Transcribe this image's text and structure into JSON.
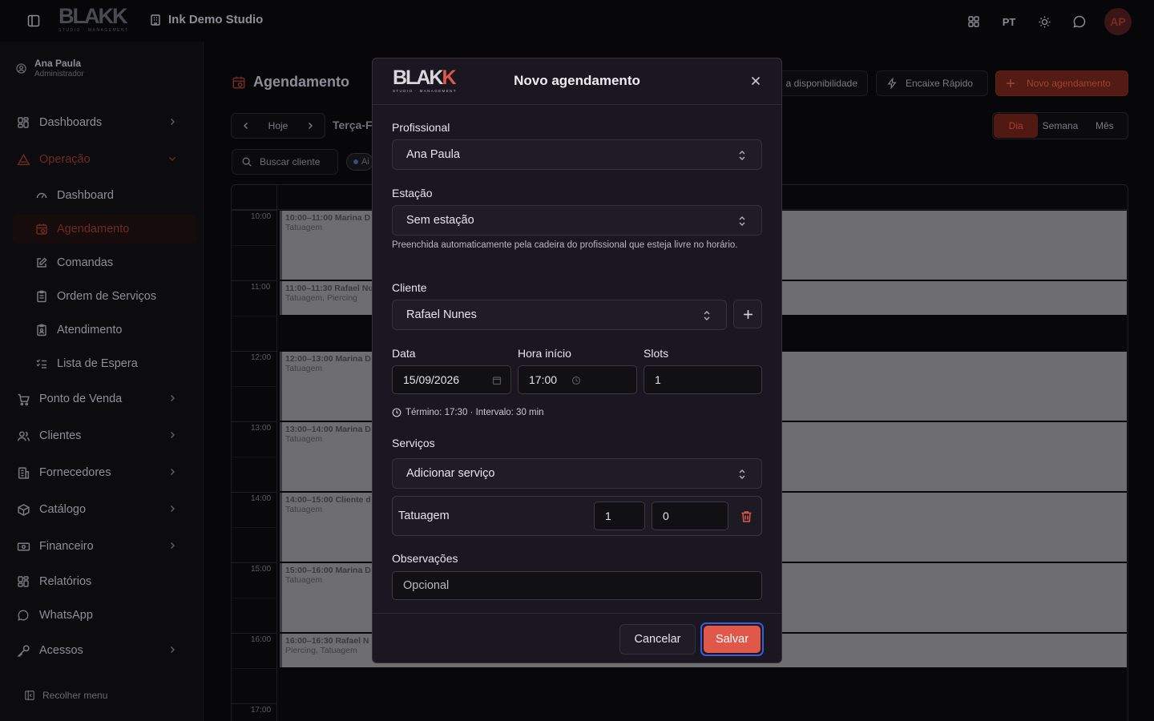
{
  "app": {
    "studio": "Ink Demo Studio",
    "logo": "BLAKK",
    "logo_sub": "STUDIO · MANAGEMENT"
  },
  "topbar": {
    "lang": "PT",
    "avatar": "AP"
  },
  "user": {
    "name": "Ana Paula",
    "role": "Administrador"
  },
  "sidebar": {
    "items": [
      {
        "label": "Dashboards",
        "icon": "grid-icon"
      },
      {
        "label": "Operação",
        "icon": "warning-icon"
      },
      {
        "label": "Ponto de Venda",
        "icon": "cart-icon"
      },
      {
        "label": "Clientes",
        "icon": "users-icon"
      },
      {
        "label": "Fornecedores",
        "icon": "building-icon"
      },
      {
        "label": "Catálogo",
        "icon": "box-icon"
      },
      {
        "label": "Financeiro",
        "icon": "banknote-icon"
      },
      {
        "label": "Relatórios",
        "icon": "grid-icon"
      },
      {
        "label": "WhatsApp",
        "icon": "chat-icon"
      },
      {
        "label": "Acessos",
        "icon": "key-icon"
      }
    ],
    "sub": [
      {
        "label": "Dashboard",
        "icon": "gauge-icon"
      },
      {
        "label": "Agendamento",
        "icon": "calendar-icon"
      },
      {
        "label": "Comandas",
        "icon": "edit-icon"
      },
      {
        "label": "Ordem de Serviços",
        "icon": "clipboard-icon"
      },
      {
        "label": "Atendimento",
        "icon": "clipboard-icon"
      },
      {
        "label": "Lista de Espera",
        "icon": "list-icon"
      }
    ],
    "collapse": "Recolher menu"
  },
  "page": {
    "title": "Agendamento",
    "actions": {
      "availability": "a disponibilidade",
      "quick_fit": "Encaixe Rápido",
      "new": "Novo agendamento"
    },
    "nav": {
      "today": "Hoje"
    },
    "date_label": "Terça-F",
    "views": [
      "Dia",
      "Semana",
      "Mês"
    ],
    "search": "Buscar cliente",
    "chip": "Ai",
    "hours": [
      "10:00",
      "11:00",
      "12:00",
      "13:00",
      "14:00",
      "15:00",
      "16:00",
      "17:00"
    ],
    "events": [
      {
        "title": "10:00–11:00 Marina D",
        "sub": "Tatuagem"
      },
      {
        "title": "11:00–11:30 Rafael Nu",
        "sub": "Tatuagem, Piercing"
      },
      {
        "title": "12:00–13:00 Marina D",
        "sub": "Tatuagem"
      },
      {
        "title": "13:00–14:00 Marina D",
        "sub": "Tatuagem"
      },
      {
        "title": "14:00–15:00 Cliente d",
        "sub": "Tatuagem"
      },
      {
        "title": "15:00–16:00 Marina D",
        "sub": "Tatuagem"
      },
      {
        "title": "16:00–16:30 Rafael N",
        "sub": "Piercing, Tatuagem"
      }
    ]
  },
  "modal": {
    "title": "Novo agendamento",
    "professional": {
      "label": "Profissional",
      "value": "Ana Paula"
    },
    "station": {
      "label": "Estação",
      "value": "Sem estação",
      "hint": "Preenchida automaticamente pela cadeira do profissional que esteja livre no horário."
    },
    "client": {
      "label": "Cliente",
      "value": "Rafael Nunes"
    },
    "date": {
      "label": "Data",
      "value": "15/09/2026"
    },
    "start": {
      "label": "Hora início",
      "value": "17:00"
    },
    "slots": {
      "label": "Slots",
      "value": "1"
    },
    "end_info": "Término: 17:30 · Intervalo: 30 min",
    "services": {
      "label": "Serviços",
      "placeholder": "Adicionar serviço",
      "items": [
        {
          "name": "Tatuagem",
          "qty": "1",
          "price": "0"
        }
      ]
    },
    "notes": {
      "label": "Observações",
      "placeholder": "Opcional"
    },
    "cancel": "Cancelar",
    "save": "Salvar"
  },
  "colors": {
    "accent": "#e0584a",
    "focus": "#3d5bd9",
    "modal_bg": "#1a1720"
  }
}
